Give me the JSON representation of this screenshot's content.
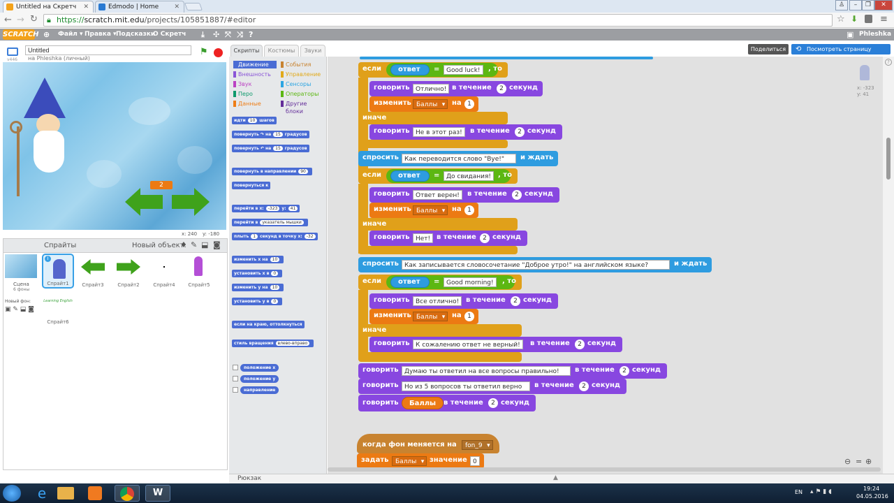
{
  "browser": {
    "tabs": [
      {
        "label": "Untitled на Скретч",
        "active": true
      },
      {
        "label": "Edmodo | Home",
        "active": false
      }
    ],
    "url_scheme": "https://",
    "url_host": "scratch.mit.edu",
    "url_path": "/projects/105851887/#editor"
  },
  "menu": {
    "logo": "SCRATCH",
    "file": "Файл ▾",
    "edit": "Правка ▾",
    "tips": "Подсказки",
    "about": "О Скретч",
    "user": "Phleshka ▾"
  },
  "project": {
    "title": "Untitled",
    "owner": "на Phleshka (личный)",
    "version": "v446"
  },
  "topbuttons": {
    "share": "Поделиться",
    "see_project": "Посмотреть страницу проекта"
  },
  "stage": {
    "counter": "2",
    "coords_x": "x: 240",
    "coords_y": "y: -180"
  },
  "sprites_panel": {
    "title": "Спрайты",
    "new_object": "Новый объект:",
    "scene_label": "Сцена",
    "scene_count": "6 фоны",
    "new_bg": "Новый фон:",
    "sprites": [
      "Спрайт1",
      "Спрайт3",
      "Спрайт2",
      "Спрайт4",
      "Спрайт5",
      "Спрайт6"
    ],
    "sprite6_thumb_text": "Learning English"
  },
  "editor_tabs": [
    "Скрипты",
    "Костюмы",
    "Звуки"
  ],
  "categories": [
    {
      "label": "Движение",
      "color": "#4a6cd4"
    },
    {
      "label": "События",
      "color": "#c88330"
    },
    {
      "label": "Внешность",
      "color": "#8a55d7"
    },
    {
      "label": "Управление",
      "color": "#e1a91a"
    },
    {
      "label": "Звук",
      "color": "#bb42c3"
    },
    {
      "label": "Сенсоры",
      "color": "#2ca5e2"
    },
    {
      "label": "Перо",
      "color": "#0e9a6c"
    },
    {
      "label": "Операторы",
      "color": "#5cb712"
    },
    {
      "label": "Данные",
      "color": "#ee7d16"
    },
    {
      "label": "Другие блоки",
      "color": "#632d99"
    }
  ],
  "palette_blocks": [
    {
      "text": "идти",
      "tail": "шагов",
      "val": "10"
    },
    {
      "text": "повернуть ↷ на",
      "tail": "градусов",
      "val": "15"
    },
    {
      "text": "повернуть ↶ на",
      "tail": "градусов",
      "val": "15"
    },
    {
      "text": "повернуть в направлении",
      "tail": "",
      "val": "90"
    },
    {
      "text": "повернуться к",
      "tail": "",
      "val": ""
    },
    {
      "text": "перейти в x:",
      "tail": "y:",
      "val": "-323",
      "val2": "41"
    },
    {
      "text": "перейти в",
      "tail": "",
      "val": "указатель мышки"
    },
    {
      "text": "плыть",
      "tail": "секунд в точку x:",
      "val": "1",
      "val2": "-32"
    },
    {
      "text": "изменить x на",
      "tail": "",
      "val": "10"
    },
    {
      "text": "установить x в",
      "tail": "",
      "val": "0"
    },
    {
      "text": "изменить y на",
      "tail": "",
      "val": "10"
    },
    {
      "text": "установить y в",
      "tail": "",
      "val": "0"
    },
    {
      "text": "если на краю, оттолкнуться",
      "tail": "",
      "val": ""
    },
    {
      "text": "стиль вращения",
      "tail": "",
      "val": "влево-вправо"
    }
  ],
  "palette_reporters": [
    "положение x",
    "положение y",
    "направление"
  ],
  "script": {
    "if": "если",
    "then": ", то",
    "else": "иначе",
    "say": "говорить",
    "during": "в течение",
    "seconds": "секунд",
    "change": "изменить",
    "on": "на",
    "ask": "спросить",
    "and_wait": "и ждать",
    "answer": "ответ",
    "eq": "=",
    "var": "Баллы",
    "ans1": "Good luck!",
    "say_ok1": "Отлично!",
    "say_no1": "Не в этот раз!",
    "q2": "Как переводится слово \"Bye!\"",
    "ans2": "До свидания!",
    "say_ok2": "Ответ верен!",
    "say_no2": "Нет!",
    "q3": "Как записывается словосочетание \"Доброе утро!\" на английском языке?",
    "ans3": "Good morning!",
    "say_ok3": "Все отлично!",
    "say_no3": "К сожалению ответ не верный!",
    "final1": "Думаю ты ответил на все вопросы правильно!",
    "final2": "Но из 5 вопросов ты ответил верно",
    "two": "2",
    "one": "1",
    "hat": "когда фон меняется на",
    "hat_val": "fon_9",
    "set": "задать",
    "set_mid": "значение",
    "set_val": "0"
  },
  "sprite_info": {
    "x": "x: -323",
    "y": "y: 41"
  },
  "backpack": "Рюкзак",
  "taskbar": {
    "lang": "EN",
    "time": "19:24",
    "date": "04.05.2016"
  }
}
